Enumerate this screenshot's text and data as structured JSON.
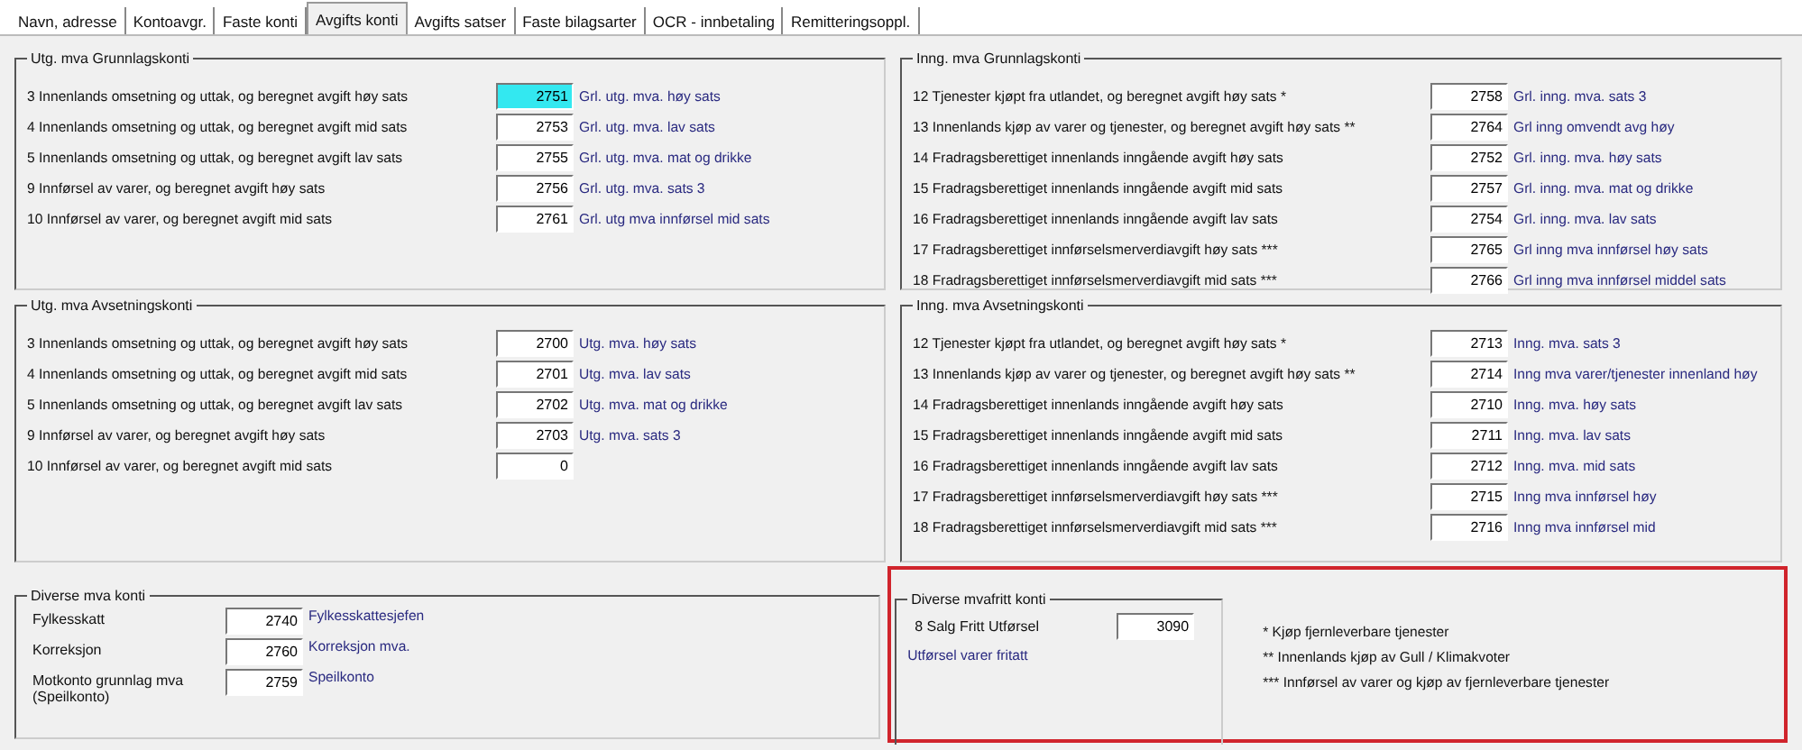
{
  "tabs": [
    {
      "label": "Navn, adresse",
      "selected": false
    },
    {
      "label": "Kontoavgr.",
      "selected": false
    },
    {
      "label": "Faste konti",
      "selected": false
    },
    {
      "label": "Avgifts konti",
      "selected": true
    },
    {
      "label": "Avgifts satser",
      "selected": false
    },
    {
      "label": "Faste bilagsarter",
      "selected": false
    },
    {
      "label": "OCR - innbetaling",
      "selected": false
    },
    {
      "label": "Remitteringsoppl.",
      "selected": false
    }
  ],
  "panels": [
    {
      "title": "Utg. mva Grunnlagskonti",
      "rows": [
        {
          "label": "3 Innenlands omsetning og uttak, og beregnet avgift høy sats",
          "account": "2751",
          "description": "Grl. utg. mva. høy sats",
          "selected": true
        },
        {
          "label": "4 Innenlands omsetning og uttak, og beregnet avgift mid sats",
          "account": "2753",
          "description": "Grl. utg. mva. lav sats",
          "selected": false
        },
        {
          "label": "5 Innenlands omsetning og uttak, og beregnet avgift lav sats",
          "account": "2755",
          "description": "Grl. utg. mva. mat og drikke",
          "selected": false
        },
        {
          "label": "9 Innførsel av varer, og beregnet avgift høy sats",
          "account": "2756",
          "description": "Grl. utg. mva. sats 3",
          "selected": false
        },
        {
          "label": "10 Innførsel av varer, og beregnet avgift mid sats",
          "account": "2761",
          "description": "Grl. utg mva innførsel mid sats",
          "selected": false
        }
      ]
    },
    {
      "title": "Inng. mva Grunnlagskonti",
      "rows": [
        {
          "label": "12 Tjenester kjøpt fra utlandet, og beregnet avgift høy sats *",
          "account": "2758",
          "description": "Grl. inng. mva. sats 3",
          "selected": false
        },
        {
          "label": "13 Innenlands kjøp av varer og tjenester, og beregnet avgift høy sats **",
          "account": "2764",
          "description": "Grl inng omvendt avg høy",
          "selected": false
        },
        {
          "label": "14 Fradragsberettiget innenlands inngående avgift høy sats",
          "account": "2752",
          "description": "Grl. inng. mva. høy sats",
          "selected": false
        },
        {
          "label": "15 Fradragsberettiget innenlands inngående avgift mid sats",
          "account": "2757",
          "description": "Grl. inng. mva. mat og drikke",
          "selected": false
        },
        {
          "label": "16 Fradragsberettiget innenlands inngående avgift lav sats",
          "account": "2754",
          "description": "Grl. inng. mva. lav sats",
          "selected": false
        },
        {
          "label": "17 Fradragsberettiget innførselsmerverdiavgift høy sats ***",
          "account": "2765",
          "description": "Grl inng mva innførsel høy sats",
          "selected": false
        },
        {
          "label": "18 Fradragsberettiget innførselsmerverdiavgift mid sats ***",
          "account": "2766",
          "description": "Grl inng mva innførsel middel sats",
          "selected": false
        }
      ]
    },
    {
      "title": "Utg. mva Avsetningskonti",
      "rows": [
        {
          "label": "3 Innenlands omsetning og uttak, og beregnet avgift høy sats",
          "account": "2700",
          "description": "Utg. mva. høy sats",
          "selected": false
        },
        {
          "label": "4 Innenlands omsetning og uttak, og beregnet avgift mid sats",
          "account": "2701",
          "description": "Utg. mva. lav sats",
          "selected": false
        },
        {
          "label": "5 Innenlands omsetning og uttak, og beregnet avgift lav sats",
          "account": "2702",
          "description": "Utg. mva. mat og drikke",
          "selected": false
        },
        {
          "label": "9 Innførsel av varer, og beregnet avgift høy sats",
          "account": "2703",
          "description": "Utg. mva. sats 3",
          "selected": false
        },
        {
          "label": "10 Innførsel av varer, og beregnet avgift mid sats",
          "account": "0",
          "selected": false
        }
      ]
    },
    {
      "title": "Inng. mva Avsetningskonti",
      "rows": [
        {
          "label": "12 Tjenester kjøpt fra utlandet, og beregnet avgift høy sats *",
          "account": "2713",
          "description": "Inng. mva. sats 3",
          "selected": false
        },
        {
          "label": "13 Innenlands kjøp av varer og tjenester, og beregnet avgift høy sats **",
          "account": "2714",
          "description": "Inng mva varer/tjenester innenland høy",
          "selected": false
        },
        {
          "label": "14 Fradragsberettiget innenlands inngående avgift høy sats",
          "account": "2710",
          "description": "Inng. mva. høy sats",
          "selected": false
        },
        {
          "label": "15 Fradragsberettiget innenlands inngående avgift mid sats",
          "account": "2711",
          "description": "Inng. mva. lav sats",
          "selected": false
        },
        {
          "label": "16 Fradragsberettiget innenlands inngående avgift lav sats",
          "account": "2712",
          "description": "Inng. mva. mid sats",
          "selected": false
        },
        {
          "label": "17 Fradragsberettiget innførselsmerverdiavgift høy sats ***",
          "account": "2715",
          "description": "Inng mva innførsel høy",
          "selected": false
        },
        {
          "label": "18 Fradragsberettiget innførselsmerverdiavgift mid sats ***",
          "account": "2716",
          "description": "Inng mva innførsel mid",
          "selected": false
        }
      ]
    }
  ],
  "diverse_mva": {
    "title": "Diverse mva konti",
    "rows": [
      {
        "label": "Fylkesskatt",
        "account": "2740",
        "description": "Fylkesskattesjefen"
      },
      {
        "label": "Korreksjon",
        "account": "2760",
        "description": "Korreksjon mva."
      },
      {
        "label": "Motkonto grunnlag mva (Speilkonto)",
        "account": "2759",
        "description": "Speilkonto"
      }
    ]
  },
  "mvafritt": {
    "title": "Diverse mvafritt konti",
    "label": "8 Salg Fritt Utførsel",
    "account": "3090",
    "description": "Utførsel varer fritatt"
  },
  "footnotes": [
    "* Kjøp fjernleverbare tjenester",
    "** Innenlands kjøp av Gull / Klimakvoter",
    "*** Innførsel av varer og kjøp av fjernleverbare tjenester"
  ]
}
